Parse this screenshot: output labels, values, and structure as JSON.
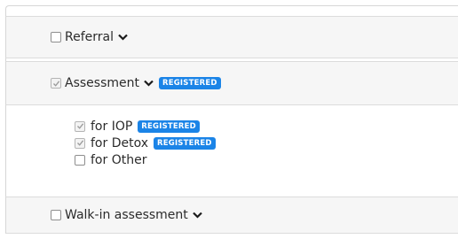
{
  "sections": [
    {
      "label": "Referral",
      "checked": false
    },
    {
      "label": "Assessment",
      "checked": true,
      "badge": "REGISTERED"
    },
    {
      "label": "Walk-in assessment",
      "checked": false
    }
  ],
  "assessment_options": [
    {
      "label": "for IOP",
      "checked": true,
      "badge": "REGISTERED"
    },
    {
      "label": "for Detox",
      "checked": true,
      "badge": "REGISTERED"
    },
    {
      "label": "for Other",
      "checked": false
    }
  ],
  "colors": {
    "badge_bg": "#1b84e7",
    "row_bg": "#f6f6f6"
  },
  "icons": {
    "chevron": "chevron-down-icon",
    "check": "checkmark-icon"
  }
}
